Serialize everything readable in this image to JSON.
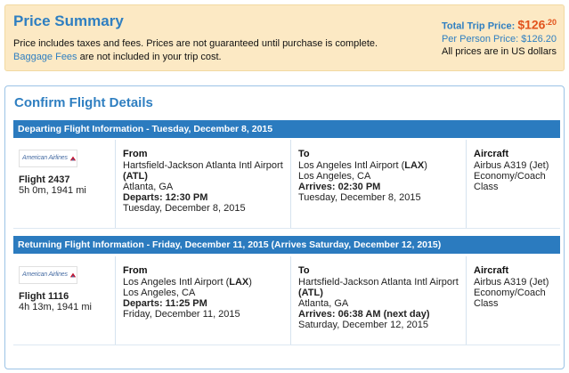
{
  "price_summary": {
    "title": "Price Summary",
    "line1": "Price includes taxes and fees. Prices are not guaranteed until purchase is complete.",
    "baggage_link": "Baggage Fees",
    "line2_rest": " are not included in your trip cost.",
    "total_label": "Total Trip Price: ",
    "total_dollars": "$126",
    "total_cents": ".20",
    "per_person": "Per Person Price: $126.20",
    "currency_note": "All prices are in US dollars"
  },
  "confirm": {
    "title": "Confirm Flight Details",
    "departing": {
      "header": "Departing Flight Information - Tuesday, December 8, 2015",
      "airline_logo": "American Airlines",
      "flight": "Flight 2437",
      "duration": "5h 0m, 1941 mi",
      "from_label": "From",
      "from_airport": "Hartsfield-Jackson Atlanta Intl Airport",
      "from_code": "(ATL)",
      "from_city": "Atlanta, GA",
      "departs_label": "Departs: 12:30 PM",
      "departs_date": "Tuesday, December 8, 2015",
      "to_label": "To",
      "to_airport": "Los Angeles Intl Airport (",
      "to_code": "LAX",
      "to_close": ")",
      "to_city": "Los Angeles, CA",
      "arrives_label": "Arrives: 02:30 PM",
      "arrives_date": "Tuesday, December 8, 2015",
      "aircraft_label": "Aircraft",
      "aircraft": "Airbus A319 (Jet)",
      "cabin1": "Economy/Coach",
      "cabin2": "Class"
    },
    "returning": {
      "header": "Returning Flight Information - Friday, December 11, 2015 (Arrives Saturday, December 12, 2015)",
      "airline_logo": "American Airlines",
      "flight": "Flight 1116",
      "duration": "4h 13m, 1941 mi",
      "from_label": "From",
      "from_airport": "Los Angeles Intl Airport (",
      "from_code": "LAX",
      "from_close": ")",
      "from_city": "Los Angeles, CA",
      "departs_label": "Departs: 11:25 PM",
      "departs_date": "Friday, December 11, 2015",
      "to_label": "To",
      "to_airport": "Hartsfield-Jackson Atlanta Intl Airport",
      "to_code": "(ATL)",
      "to_city": "Atlanta, GA",
      "arrives_label": "Arrives: 06:38 AM (next day)",
      "arrives_date": "Saturday, December 12, 2015",
      "aircraft_label": "Aircraft",
      "aircraft": "Airbus A319 (Jet)",
      "cabin1": "Economy/Coach",
      "cabin2": "Class"
    }
  },
  "colors": {
    "accent_blue": "#2f7fc1",
    "bar_blue": "#2b7bbf",
    "price_orange": "#e2531c",
    "summary_bg": "#fce9c4"
  }
}
